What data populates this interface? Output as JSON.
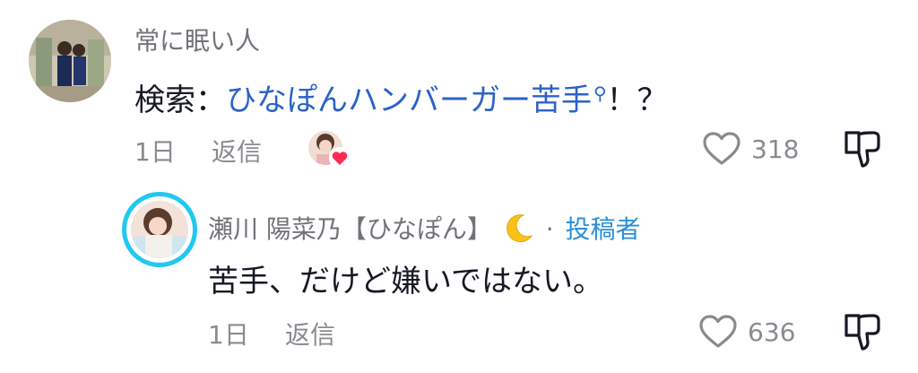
{
  "comments": [
    {
      "username": "常に眠い人",
      "text_prefix": "検索：",
      "search_term": "ひなぽんハンバーガー苦手",
      "text_suffix": "！？",
      "time": "1日",
      "reply_label": "返信",
      "like_count": "318",
      "liked_by_author": true
    },
    {
      "username": "瀬川 陽菜乃【ひなぽん】",
      "separator": "·",
      "author_badge": "投稿者",
      "text": "苦手、だけど嫌いではない。",
      "time": "1日",
      "reply_label": "返信",
      "like_count": "636"
    }
  ],
  "icons": {
    "like": "heart-outline-icon",
    "dislike": "thumbs-down-outline-icon",
    "search": "search-icon",
    "moon": "crescent-moon-emoji",
    "liked_badge": "heart-filled-icon"
  },
  "colors": {
    "link": "#2b63c6",
    "author_badge": "#2b8fd6",
    "avatar_ring": "#22c8f0",
    "liked_heart": "#fe2c55"
  }
}
